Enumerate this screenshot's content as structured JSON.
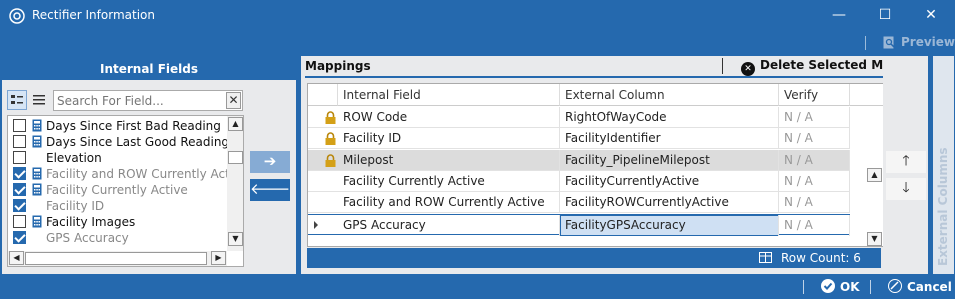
{
  "window": {
    "title": "Rectifier Information",
    "minimize_glyph": "—",
    "maximize_glyph": "☐",
    "close_glyph": "✕"
  },
  "toolbar": {
    "preview_label": "Preview"
  },
  "internal_fields": {
    "header": "Internal Fields",
    "search_placeholder": "Search For Field...",
    "clear_glyph": "✕",
    "items": [
      {
        "label": "Days Since First Bad Reading",
        "checked": false,
        "calc": true,
        "dim": false
      },
      {
        "label": "Days Since Last Good Reading",
        "checked": false,
        "calc": true,
        "dim": false
      },
      {
        "label": "Elevation",
        "checked": false,
        "calc": false,
        "dim": false
      },
      {
        "label": "Facility and ROW Currently Active",
        "checked": true,
        "calc": true,
        "dim": true
      },
      {
        "label": "Facility Currently Active",
        "checked": true,
        "calc": true,
        "dim": true
      },
      {
        "label": "Facility ID",
        "checked": true,
        "calc": false,
        "dim": true
      },
      {
        "label": "Facility Images",
        "checked": false,
        "calc": true,
        "dim": false
      },
      {
        "label": "GPS Accuracy",
        "checked": true,
        "calc": false,
        "dim": true
      }
    ],
    "add_glyph": "➔",
    "remove_glyph": "🡐"
  },
  "mappings": {
    "header": "Mappings",
    "delete_label": "Delete Selected Map",
    "columns": [
      "Internal Field",
      "External Column",
      "Verify"
    ],
    "rows": [
      {
        "internal": "ROW Code",
        "external": "RightOfWayCode",
        "verify": "N / A",
        "locked": true
      },
      {
        "internal": "Facility ID",
        "external": "FacilityIdentifier",
        "verify": "N / A",
        "locked": true
      },
      {
        "internal": "Milepost",
        "external": "Facility_PipelineMilepost",
        "verify": "N / A",
        "locked": true
      },
      {
        "internal": "Facility Currently Active",
        "external": "FacilityCurrentlyActive",
        "verify": "N / A",
        "locked": false
      },
      {
        "internal": "Facility and ROW Currently Active",
        "external": "FacilityROWCurrentlyActive",
        "verify": "N / A",
        "locked": false
      },
      {
        "internal": "GPS Accuracy",
        "external": "FacilityGPSAccuracy",
        "verify": "N / A",
        "locked": false
      }
    ],
    "row_count_label": "Row Count:  6"
  },
  "side": {
    "up_glyph": "🡑",
    "down_glyph": "🡓"
  },
  "external_columns": {
    "label": "External Columns"
  },
  "footer": {
    "ok_label": "OK",
    "cancel_label": "Cancel"
  },
  "colors": {
    "accent": "#2569ae",
    "selected_row": "#dcdcdc",
    "current_cell": "#cfe0f3"
  }
}
